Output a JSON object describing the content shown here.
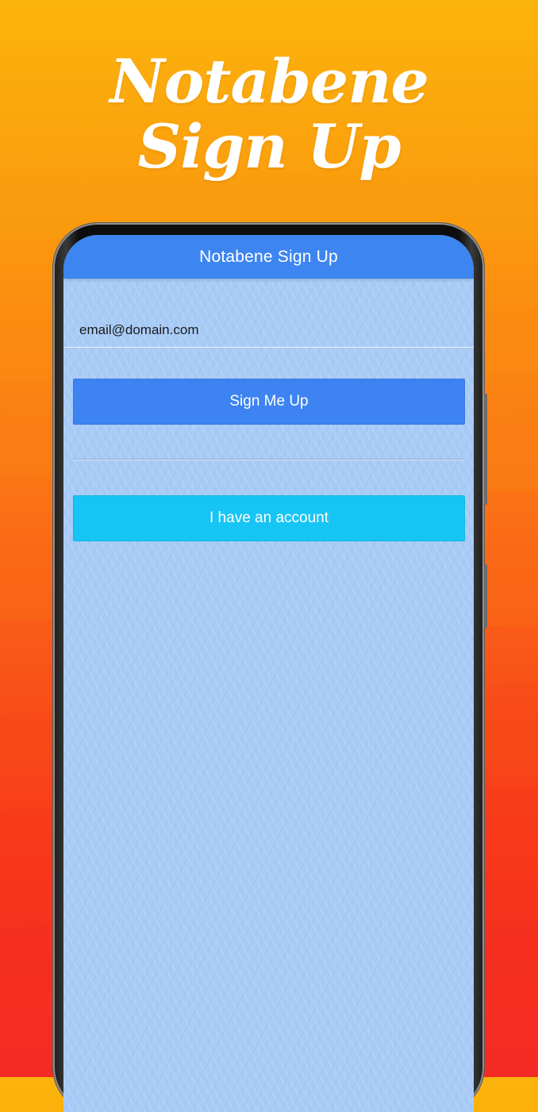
{
  "promo": {
    "title_line1": "Notabene",
    "title_line2": "Sign Up"
  },
  "app": {
    "header_title": "Notabene Sign Up",
    "email_placeholder": "email@domain.com",
    "signup_button": "Sign Me Up",
    "account_button": "I have an account"
  },
  "colors": {
    "header": "#3d85f0",
    "signup_button": "#3d83f2",
    "account_button": "#17c5f4",
    "screen_background": "#a7cbf6"
  }
}
